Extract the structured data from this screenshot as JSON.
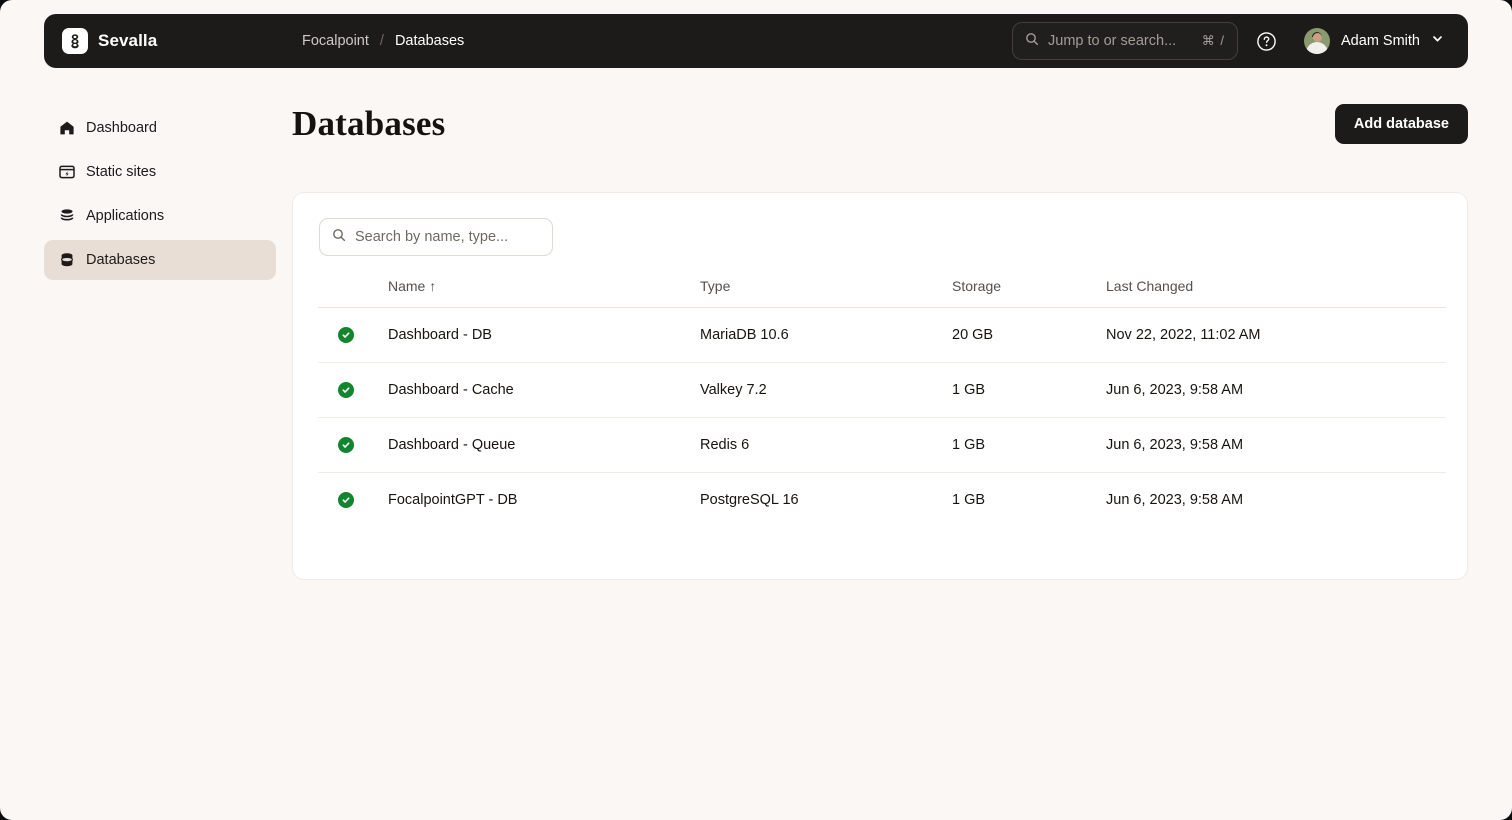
{
  "topbar": {
    "brand_name": "Sevalla",
    "breadcrumb": {
      "project": "Focalpoint",
      "separator": "/",
      "current": "Databases"
    },
    "search": {
      "placeholder": "Jump to or search...",
      "shortcut": "⌘ /"
    },
    "user": {
      "name": "Adam Smith"
    }
  },
  "sidebar": {
    "items": [
      {
        "label": "Dashboard",
        "icon": "home-icon",
        "active": false
      },
      {
        "label": "Static sites",
        "icon": "static-sites-icon",
        "active": false
      },
      {
        "label": "Applications",
        "icon": "applications-icon",
        "active": false
      },
      {
        "label": "Databases",
        "icon": "database-icon",
        "active": true
      }
    ]
  },
  "main": {
    "title": "Databases",
    "add_button": "Add database",
    "search_placeholder": "Search by name, type...",
    "table": {
      "columns": [
        "",
        "Name",
        "Type",
        "Storage",
        "Last Changed"
      ],
      "sorted_column": "Name",
      "sort_arrow": "↑",
      "rows": [
        {
          "status": "healthy",
          "name": "Dashboard - DB",
          "type": "MariaDB 10.6",
          "storage": "20 GB",
          "last_changed": "Nov 22, 2022, 11:02 AM"
        },
        {
          "status": "healthy",
          "name": "Dashboard - Cache",
          "type": "Valkey 7.2",
          "storage": "1 GB",
          "last_changed": "Jun 6, 2023, 9:58 AM"
        },
        {
          "status": "healthy",
          "name": "Dashboard - Queue",
          "type": "Redis 6",
          "storage": "1 GB",
          "last_changed": "Jun 6, 2023, 9:58 AM"
        },
        {
          "status": "healthy",
          "name": "FocalpointGPT - DB",
          "type": "PostgreSQL 16",
          "storage": "1 GB",
          "last_changed": "Jun 6, 2023, 9:58 AM"
        }
      ]
    }
  },
  "colors": {
    "page_background": "#faf7f4",
    "topbar_background": "#1c1b1a",
    "active_nav_background": "#e9ded6",
    "status_healthy": "#13852f",
    "card_background": "#ffffff"
  }
}
